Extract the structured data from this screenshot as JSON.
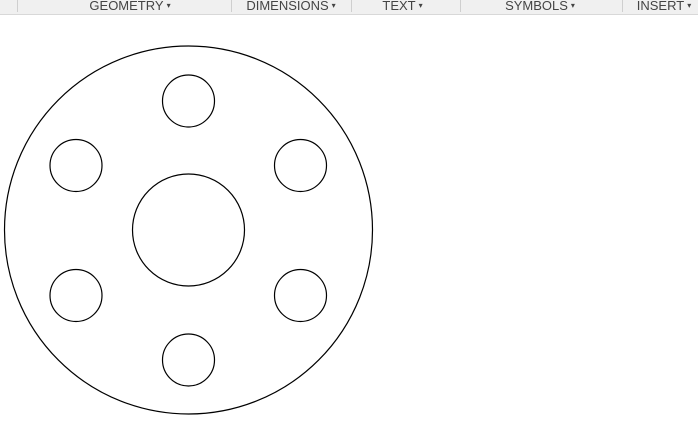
{
  "toolbar": {
    "menus": [
      {
        "label": "GEOMETRY",
        "caret": "▾"
      },
      {
        "label": "DIMENSIONS",
        "caret": "▾"
      },
      {
        "label": "TEXT",
        "caret": "▾"
      },
      {
        "label": "SYMBOLS",
        "caret": "▾"
      },
      {
        "label": "INSERT",
        "caret": "▾"
      }
    ]
  },
  "drawing": {
    "description_shapes": [
      "outer-circle",
      "center-hole",
      "bolt-holes"
    ],
    "stroke_color": "#000000",
    "background": "#ffffff",
    "bolt_hole_count": 6
  }
}
